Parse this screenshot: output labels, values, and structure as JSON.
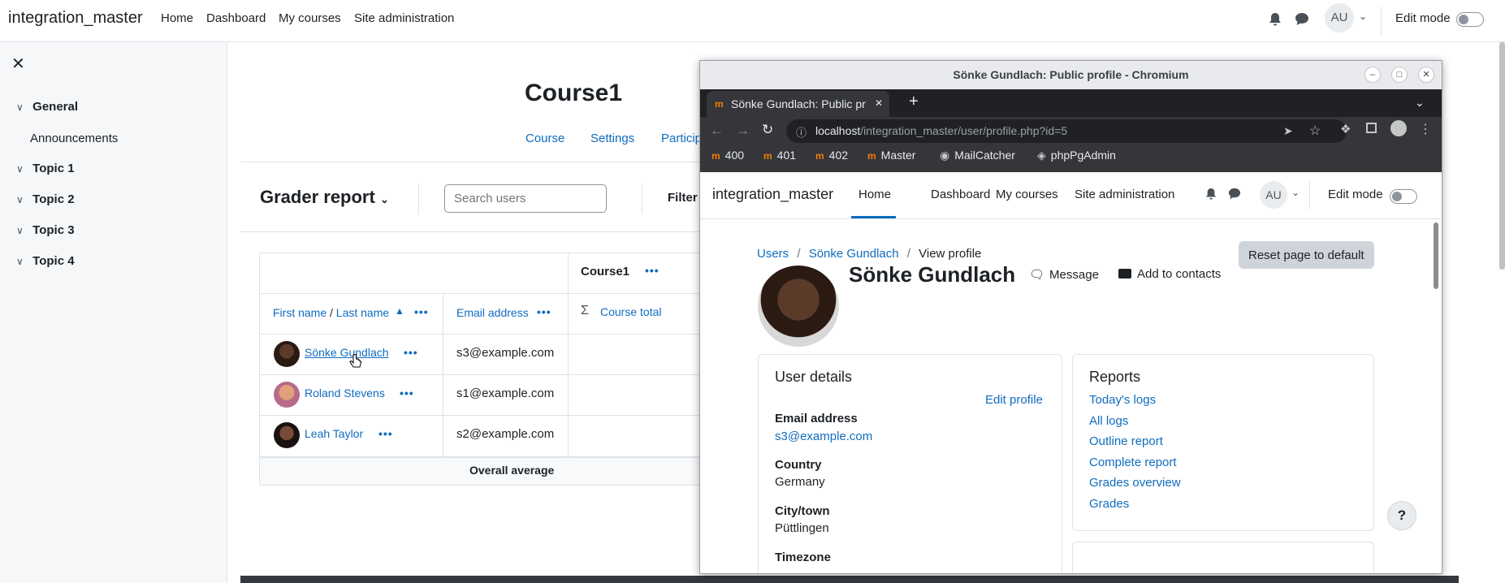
{
  "topnav": {
    "brand": "integration_master",
    "links": [
      "Home",
      "Dashboard",
      "My courses",
      "Site administration"
    ],
    "avatar": "AU",
    "edit_mode": "Edit mode"
  },
  "drawer": {
    "sections": [
      "General",
      "Topic 1",
      "Topic 2",
      "Topic 3",
      "Topic 4"
    ],
    "items": [
      "Announcements"
    ]
  },
  "course": {
    "title": "Course1",
    "tabs": [
      "Course",
      "Settings",
      "Particip"
    ]
  },
  "grader": {
    "title": "Grader report",
    "search_placeholder": "Search users",
    "filter": "Filter",
    "header_course": "Course1",
    "col_first": "First name",
    "col_sep": " / ",
    "col_last": "Last name",
    "col_email": "Email address",
    "col_total": "Course total",
    "rows": [
      {
        "name": "Sönke Gundlach",
        "email": "s3@example.com"
      },
      {
        "name": "Roland Stevens",
        "email": "s1@example.com"
      },
      {
        "name": "Leah Taylor",
        "email": "s2@example.com"
      }
    ],
    "overall": "Overall average"
  },
  "chromium": {
    "window_title": "Sönke Gundlach: Public profile - Chromium",
    "tab_title": "Sönke Gundlach: Public pr",
    "url_host": "localhost",
    "url_path": "/integration_master/user/profile.php?id=5",
    "bookmarks": [
      "400",
      "401",
      "402",
      "Master",
      "MailCatcher",
      "phpPgAdmin"
    ]
  },
  "profile": {
    "brand": "integration_master",
    "links": [
      "Home",
      "Dashboard",
      "My courses",
      "Site administration"
    ],
    "avatar": "AU",
    "edit_mode": "Edit mode",
    "breadcrumb": [
      "Users",
      "Sönke Gundlach",
      "View profile"
    ],
    "reset": "Reset page to default",
    "name": "Sönke Gundlach",
    "message": "Message",
    "add_contacts": "Add to contacts",
    "user_details": "User details",
    "edit_profile": "Edit profile",
    "email_label": "Email address",
    "email": "s3@example.com",
    "country_label": "Country",
    "country": "Germany",
    "city_label": "City/town",
    "city": "Püttlingen",
    "timezone_label": "Timezone",
    "reports_title": "Reports",
    "reports": [
      "Today's logs",
      "All logs",
      "Outline report",
      "Complete report",
      "Grades overview",
      "Grades"
    ],
    "help": "?"
  }
}
